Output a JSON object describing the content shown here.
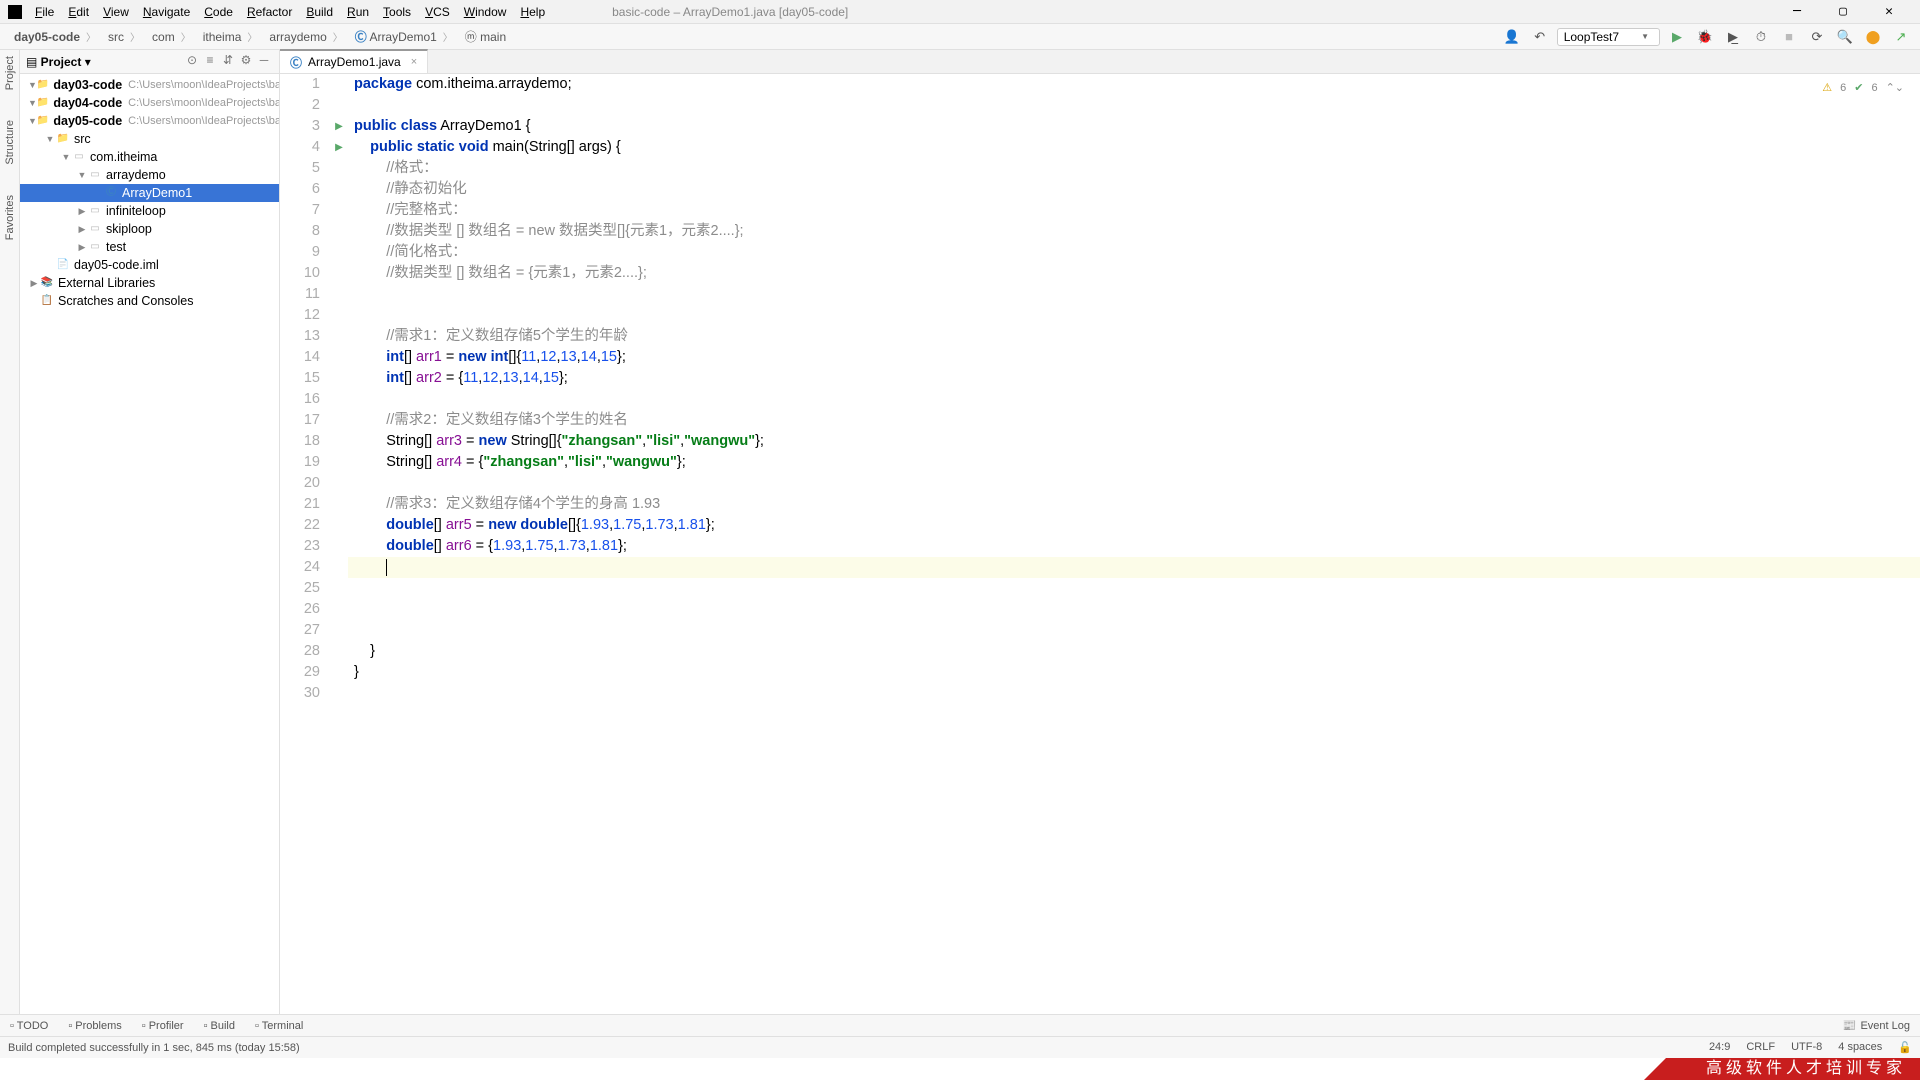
{
  "menu": {
    "items": [
      "File",
      "Edit",
      "View",
      "Navigate",
      "Code",
      "Refactor",
      "Build",
      "Run",
      "Tools",
      "VCS",
      "Window",
      "Help"
    ],
    "title": "basic-code – ArrayDemo1.java [day05-code]"
  },
  "breadcrumb": {
    "root": "day05-code",
    "parts": [
      "src",
      "com",
      "itheima",
      "arraydemo"
    ],
    "clazz": "ArrayDemo1",
    "method": "main"
  },
  "toolbar": {
    "run_config": "LoopTest7"
  },
  "project": {
    "title": "Project",
    "nodes": [
      {
        "depth": 0,
        "chv": "▼",
        "icon": "folder",
        "label": "day03-code",
        "dim": "C:\\Users\\moon\\IdeaProjects\\basic-cod"
      },
      {
        "depth": 0,
        "chv": "▼",
        "icon": "folder",
        "label": "day04-code",
        "dim": "C:\\Users\\moon\\IdeaProjects\\basic-cod"
      },
      {
        "depth": 0,
        "chv": "▼",
        "icon": "folder",
        "label": "day05-code",
        "dim": "C:\\Users\\moon\\IdeaProjects\\basic-cod"
      },
      {
        "depth": 1,
        "chv": "▼",
        "icon": "src",
        "label": "src"
      },
      {
        "depth": 2,
        "chv": "▼",
        "icon": "pkg",
        "label": "com.itheima"
      },
      {
        "depth": 3,
        "chv": "▼",
        "icon": "pkg",
        "label": "arraydemo"
      },
      {
        "depth": 4,
        "chv": "",
        "icon": "class",
        "label": "ArrayDemo1",
        "sel": true
      },
      {
        "depth": 3,
        "chv": "▶",
        "icon": "pkg",
        "label": "infiniteloop"
      },
      {
        "depth": 3,
        "chv": "▶",
        "icon": "pkg",
        "label": "skiploop"
      },
      {
        "depth": 3,
        "chv": "▶",
        "icon": "pkg",
        "label": "test"
      },
      {
        "depth": 1,
        "chv": "",
        "icon": "file",
        "label": "day05-code.iml"
      },
      {
        "depth": 0,
        "chv": "▶",
        "icon": "lib",
        "label": "External Libraries"
      },
      {
        "depth": 0,
        "chv": "",
        "icon": "scratch",
        "label": "Scratches and Consoles"
      }
    ]
  },
  "tab": {
    "name": "ArrayDemo1.java"
  },
  "code_lines": [
    {
      "n": 1,
      "html": "<span class='kw'>package</span> com.itheima.arraydemo;"
    },
    {
      "n": 2,
      "html": ""
    },
    {
      "n": 3,
      "run": true,
      "html": "<span class='kw'>public</span> <span class='kw'>class</span> ArrayDemo1 {"
    },
    {
      "n": 4,
      "run": true,
      "html": "    <span class='kw'>public static void</span> main(String[] args) {"
    },
    {
      "n": 5,
      "html": "        <span class='cmt'>//格式：</span>"
    },
    {
      "n": 6,
      "html": "        <span class='cmt'>//静态初始化</span>"
    },
    {
      "n": 7,
      "html": "        <span class='cmt'>//完整格式：</span>"
    },
    {
      "n": 8,
      "html": "        <span class='cmt'>//数据类型 [] 数组名 = new 数据类型[]{元素1，元素2....};</span>"
    },
    {
      "n": 9,
      "html": "        <span class='cmt'>//简化格式：</span>"
    },
    {
      "n": 10,
      "html": "        <span class='cmt'>//数据类型 [] 数组名 = {元素1，元素2....};</span>"
    },
    {
      "n": 11,
      "html": ""
    },
    {
      "n": 12,
      "html": ""
    },
    {
      "n": 13,
      "html": "        <span class='cmt'>//需求1：定义数组存储5个学生的年龄</span>"
    },
    {
      "n": 14,
      "html": "        <span class='kw'>int</span>[] <span class='id'>arr1</span> = <span class='kw'>new</span> <span class='kw'>int</span>[]{<span class='num'>11</span>,<span class='num'>12</span>,<span class='num'>13</span>,<span class='num'>14</span>,<span class='num'>15</span>};"
    },
    {
      "n": 15,
      "html": "        <span class='kw'>int</span>[] <span class='id'>arr2</span> = {<span class='num'>11</span>,<span class='num'>12</span>,<span class='num'>13</span>,<span class='num'>14</span>,<span class='num'>15</span>};"
    },
    {
      "n": 16,
      "html": ""
    },
    {
      "n": 17,
      "html": "        <span class='cmt'>//需求2：定义数组存储3个学生的姓名</span>"
    },
    {
      "n": 18,
      "html": "        String[] <span class='id'>arr3</span> = <span class='kw'>new</span> String[]{<span class='str'>\"zhangsan\"</span>,<span class='str'>\"lisi\"</span>,<span class='str'>\"wangwu\"</span>};"
    },
    {
      "n": 19,
      "html": "        String[] <span class='id'>arr4</span> = {<span class='str'>\"zhangsan\"</span>,<span class='str'>\"lisi\"</span>,<span class='str'>\"wangwu\"</span>};"
    },
    {
      "n": 20,
      "html": ""
    },
    {
      "n": 21,
      "html": "        <span class='cmt'>//需求3：定义数组存储4个学生的身高 1.93</span>"
    },
    {
      "n": 22,
      "html": "        <span class='kw'>double</span>[] <span class='id'>arr5</span> = <span class='kw'>new</span> <span class='kw'>double</span>[]{<span class='num'>1.93</span>,<span class='num'>1.75</span>,<span class='num'>1.73</span>,<span class='num'>1.81</span>};"
    },
    {
      "n": 23,
      "html": "        <span class='kw'>double</span>[] <span class='id'>arr6</span> = {<span class='num'>1.93</span>,<span class='num'>1.75</span>,<span class='num'>1.73</span>,<span class='num'>1.81</span>};"
    },
    {
      "n": 24,
      "hl": true,
      "html": "        <span class='caret'></span>"
    },
    {
      "n": 25,
      "html": ""
    },
    {
      "n": 26,
      "html": ""
    },
    {
      "n": 27,
      "html": ""
    },
    {
      "n": 28,
      "html": "    }"
    },
    {
      "n": 29,
      "html": "}"
    },
    {
      "n": 30,
      "html": ""
    }
  ],
  "ed_status": {
    "warn": "6",
    "ok": "6"
  },
  "bottom": {
    "items": [
      "TODO",
      "Problems",
      "Profiler",
      "Build",
      "Terminal"
    ],
    "right": "Event Log"
  },
  "status": {
    "left": "Build completed successfully in 1 sec, 845 ms (today 15:58)",
    "pos": "24:9",
    "eol": "CRLF",
    "enc": "UTF-8",
    "indent": "4 spaces"
  },
  "banner": "高级软件人才培训专家"
}
